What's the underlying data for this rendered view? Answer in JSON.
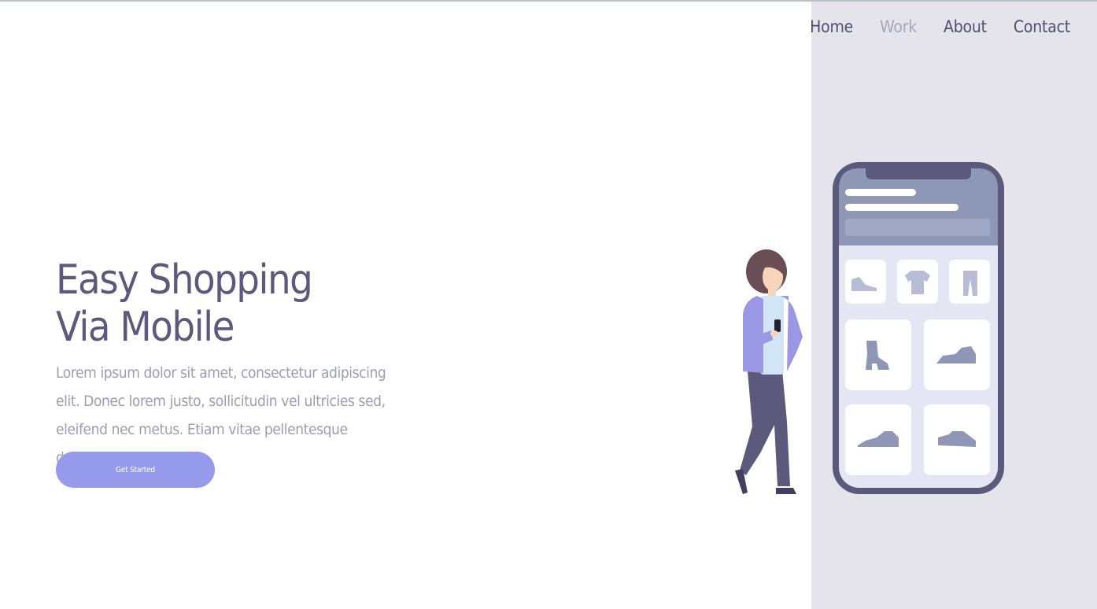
{
  "nav": {
    "items": [
      {
        "label": "Home",
        "active": false
      },
      {
        "label": "Work",
        "active": true
      },
      {
        "label": "About",
        "active": false
      },
      {
        "label": "Contact",
        "active": false
      }
    ]
  },
  "hero": {
    "title_line1": "Easy Shopping",
    "title_line2": "Via Mobile",
    "description": "Lorem ipsum dolor sit amet, consectetur adipiscing elit. Donec lorem justo, sollicitudin vel ultricies sed, eleifend nec metus. Etiam vitae pellentesque dolor.",
    "cta_label": "Get Started"
  },
  "colors": {
    "panel_bg": "#e4e4ea",
    "heading": "#5b5a7c",
    "body_text": "#9c9cb2",
    "accent": "#969aea",
    "nav_active": "#a6a6bd"
  },
  "illustration": {
    "phone_icons": [
      "flat-shoe-icon",
      "tshirt-icon",
      "pants-icon",
      "boot-icon",
      "sneaker-icon",
      "sneaker-icon",
      "sneaker-icon"
    ]
  }
}
